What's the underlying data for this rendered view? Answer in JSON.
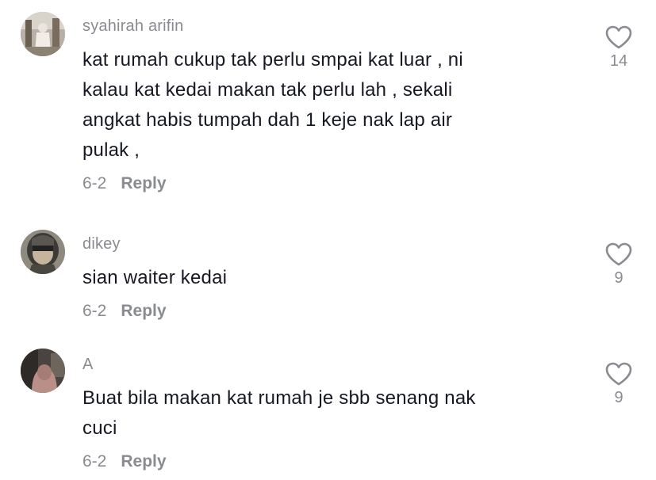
{
  "comments": [
    {
      "username": "syahirah arifin",
      "text": "kat rumah cukup tak perlu smpai kat luar , ni\nkalau kat kedai makan tak perlu lah , sekali\nangkat habis tumpah dah 1 keje nak lap air\npulak ,",
      "date": "6-2",
      "reply_label": "Reply",
      "likes": "14"
    },
    {
      "username": "dikey",
      "text": "sian waiter kedai",
      "date": "6-2",
      "reply_label": "Reply",
      "likes": "9"
    },
    {
      "username": "A",
      "text": "Buat bila makan kat rumah je sbb senang nak\ncuci",
      "date": "6-2",
      "reply_label": "Reply",
      "likes": "9"
    }
  ],
  "icons": {
    "like": "heart-outline-icon"
  },
  "colors": {
    "text": "#161823",
    "secondary": "#8a8b91",
    "background": "#ffffff"
  }
}
